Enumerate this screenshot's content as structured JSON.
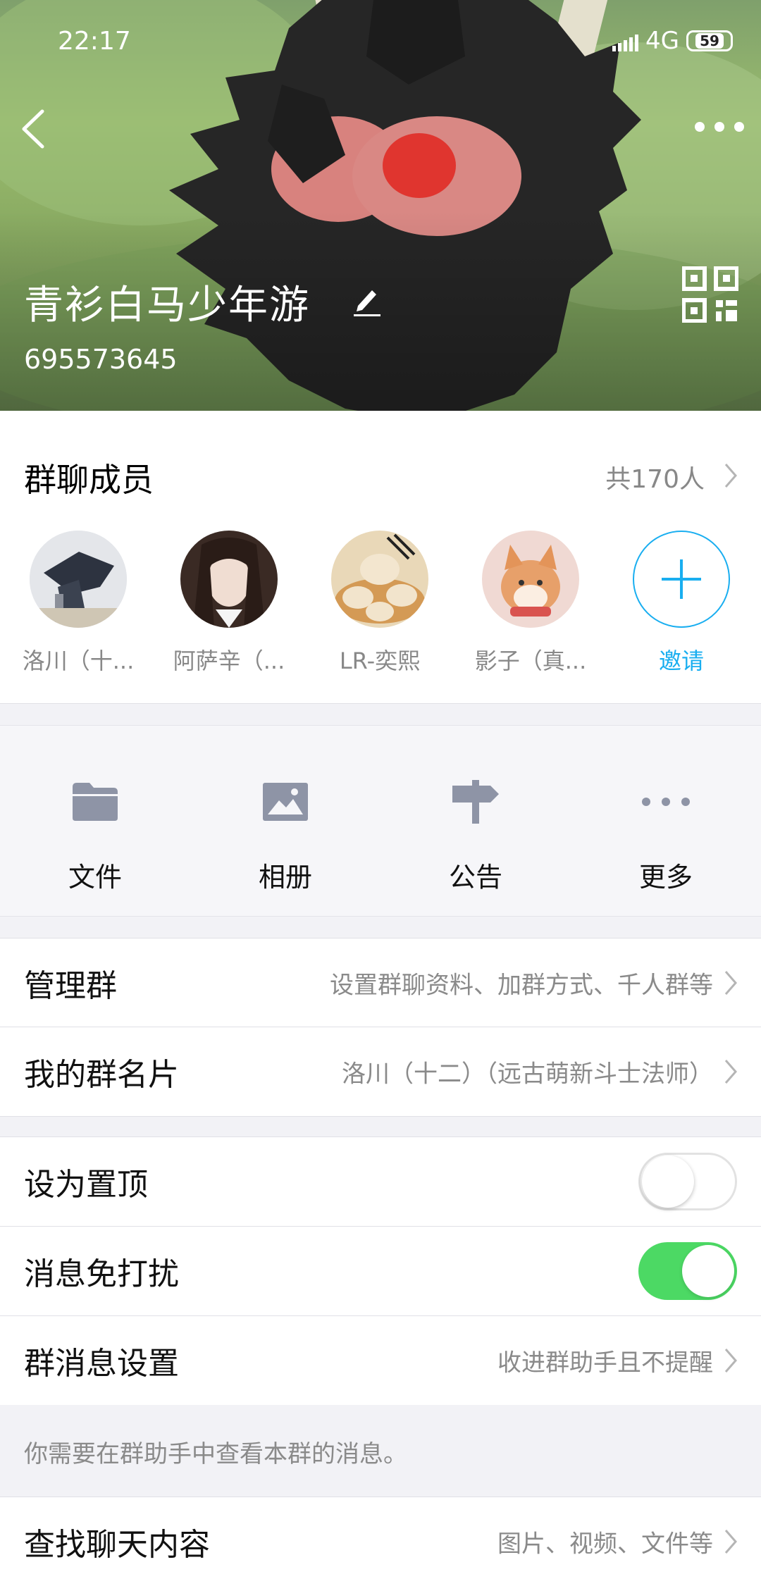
{
  "status_bar": {
    "time": "22:17",
    "network": "4G",
    "battery": "59"
  },
  "header": {
    "group_name": "青衫白马少年游",
    "group_id": "695573645"
  },
  "members": {
    "title": "群聊成员",
    "count": "共170人",
    "list": [
      {
        "name": "洛川（十..."
      },
      {
        "name": "阿萨辛（..."
      },
      {
        "name": "LR-奕熙"
      },
      {
        "name": "影子（真..."
      }
    ],
    "invite_label": "邀请"
  },
  "features": [
    {
      "label": "文件",
      "icon": "folder-icon"
    },
    {
      "label": "相册",
      "icon": "photo-album-icon"
    },
    {
      "label": "公告",
      "icon": "signpost-icon"
    },
    {
      "label": "更多",
      "icon": "more-dots-icon"
    }
  ],
  "settings": {
    "manage": {
      "label": "管理群",
      "value": "设置群聊资料、加群方式、千人群等"
    },
    "card": {
      "label": "我的群名片",
      "value": "洛川（十二）（远古萌新斗士法师）"
    },
    "pin": {
      "label": "设为置顶",
      "on": false
    },
    "mute": {
      "label": "消息免打扰",
      "on": true
    },
    "msg_settings": {
      "label": "群消息设置",
      "value": "收进群助手且不提醒"
    },
    "hint": "你需要在群助手中查看本群的消息。",
    "search": {
      "label": "查找聊天内容",
      "value": "图片、视频、文件等"
    }
  },
  "colors": {
    "accent": "#19aef0",
    "toggle_on": "#4cd964",
    "icon_gray": "#8e94a6"
  }
}
